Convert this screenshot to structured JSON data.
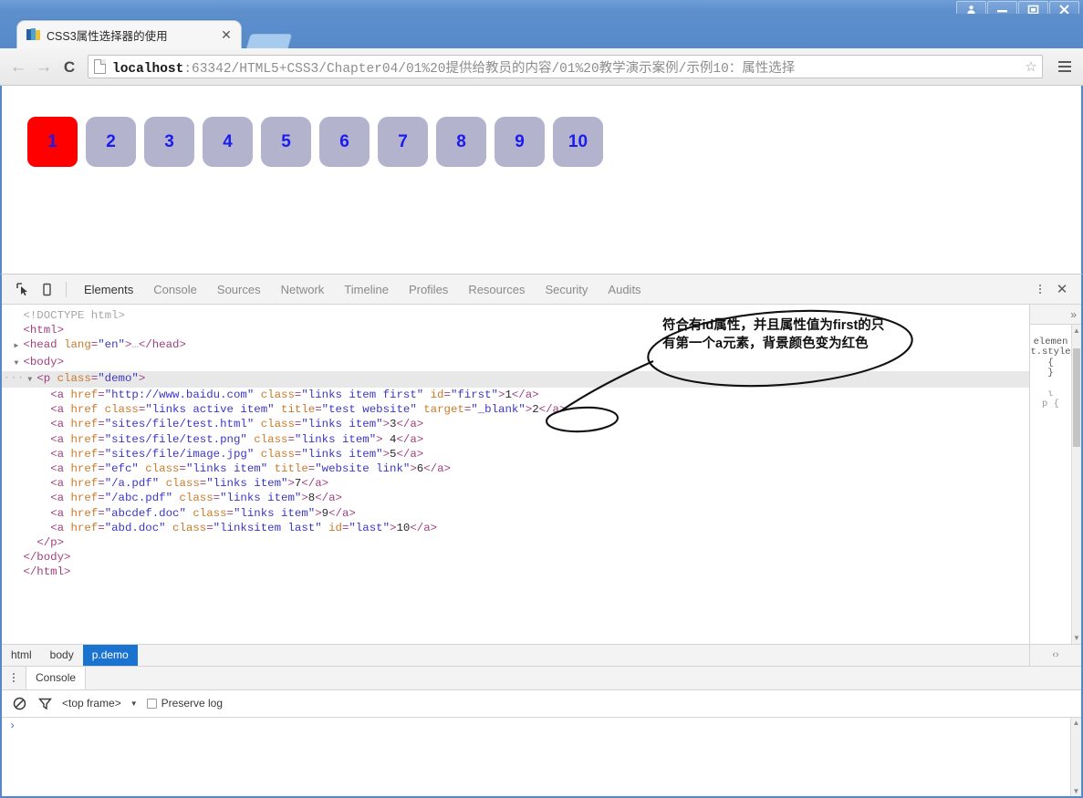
{
  "window": {
    "controls": [
      {
        "name": "user-profile",
        "glyph": "☻"
      },
      {
        "name": "minimize",
        "glyph": "–"
      },
      {
        "name": "maximize",
        "glyph": "□"
      },
      {
        "name": "close",
        "glyph": "✕"
      }
    ]
  },
  "tab": {
    "title": "CSS3属性选择器的使用",
    "close_label": "✕",
    "favicon_name": "page-favicon"
  },
  "toolbar": {
    "back_label": "←",
    "forward_label": "→",
    "reload_label": "C",
    "url_host": "localhost",
    "url_rest": ":63342/HTML5+CSS3/Chapter04/01%20提供给教员的内容/01%20教学演示案例/示例10：属性选择",
    "star_label": "☆",
    "menu_name": "chrome-menu-icon"
  },
  "page": {
    "links": [
      {
        "label": "1",
        "active": true
      },
      {
        "label": "2",
        "active": false
      },
      {
        "label": "3",
        "active": false
      },
      {
        "label": "4",
        "active": false
      },
      {
        "label": "5",
        "active": false
      },
      {
        "label": "6",
        "active": false
      },
      {
        "label": "7",
        "active": false
      },
      {
        "label": "8",
        "active": false
      },
      {
        "label": "9",
        "active": false
      },
      {
        "label": "10",
        "active": false
      }
    ],
    "active_color": "#fe0000",
    "inactive_color": "#b3b3cd",
    "number_color": "#1b1bf0"
  },
  "devtools": {
    "inspect_icon": "inspect-element-icon",
    "device_icon": "device-toolbar-icon",
    "tabs": [
      {
        "label": "Elements",
        "active": true
      },
      {
        "label": "Console",
        "active": false
      },
      {
        "label": "Sources",
        "active": false
      },
      {
        "label": "Network",
        "active": false
      },
      {
        "label": "Timeline",
        "active": false
      },
      {
        "label": "Profiles",
        "active": false
      },
      {
        "label": "Resources",
        "active": false
      },
      {
        "label": "Security",
        "active": false
      },
      {
        "label": "Audits",
        "active": false
      }
    ],
    "more_label": "⋮",
    "close_label": "✕",
    "dom": [
      {
        "indent": 0,
        "arrow": "",
        "selected": false,
        "dots": false,
        "parts": [
          {
            "c": "dim",
            "t": "<!DOCTYPE html>"
          }
        ]
      },
      {
        "indent": 0,
        "arrow": "",
        "selected": false,
        "dots": false,
        "parts": [
          {
            "c": "tag",
            "t": "<html>"
          }
        ]
      },
      {
        "indent": 0,
        "arrow": "▶",
        "selected": false,
        "dots": false,
        "parts": [
          {
            "c": "tag",
            "t": "<head "
          },
          {
            "c": "attr",
            "t": "lang"
          },
          {
            "c": "tag",
            "t": "="
          },
          {
            "c": "val",
            "t": "\"en\""
          },
          {
            "c": "tag",
            "t": ">"
          },
          {
            "c": "dim",
            "t": "…"
          },
          {
            "c": "tag",
            "t": "</head>"
          }
        ]
      },
      {
        "indent": 0,
        "arrow": "▼",
        "selected": false,
        "dots": false,
        "parts": [
          {
            "c": "tag",
            "t": "<body>"
          }
        ]
      },
      {
        "indent": 1,
        "arrow": "▼",
        "selected": true,
        "dots": true,
        "parts": [
          {
            "c": "tag",
            "t": "<p "
          },
          {
            "c": "attr",
            "t": "class"
          },
          {
            "c": "tag",
            "t": "="
          },
          {
            "c": "val",
            "t": "\"demo\""
          },
          {
            "c": "tag",
            "t": ">"
          }
        ]
      },
      {
        "indent": 2,
        "arrow": "",
        "selected": false,
        "dots": false,
        "parts": [
          {
            "c": "tag",
            "t": "<a "
          },
          {
            "c": "attr",
            "t": "href"
          },
          {
            "c": "tag",
            "t": "="
          },
          {
            "c": "val",
            "t": "\"http://www.baidu.com\""
          },
          {
            "c": "attr",
            "t": " class"
          },
          {
            "c": "tag",
            "t": "="
          },
          {
            "c": "val",
            "t": "\"links item first\""
          },
          {
            "c": "attr",
            "t": " id"
          },
          {
            "c": "tag",
            "t": "="
          },
          {
            "c": "val",
            "t": "\"first\""
          },
          {
            "c": "tag",
            "t": ">"
          },
          {
            "c": "txt",
            "t": "1"
          },
          {
            "c": "tag",
            "t": "</a>"
          }
        ]
      },
      {
        "indent": 2,
        "arrow": "",
        "selected": false,
        "dots": false,
        "parts": [
          {
            "c": "tag",
            "t": "<a "
          },
          {
            "c": "attr",
            "t": "href"
          },
          {
            "c": "attr",
            "t": " class"
          },
          {
            "c": "tag",
            "t": "="
          },
          {
            "c": "val",
            "t": "\"links active item\""
          },
          {
            "c": "attr",
            "t": " title"
          },
          {
            "c": "tag",
            "t": "="
          },
          {
            "c": "val",
            "t": "\"test website\""
          },
          {
            "c": "attr",
            "t": " target"
          },
          {
            "c": "tag",
            "t": "="
          },
          {
            "c": "val",
            "t": "\"_blank\""
          },
          {
            "c": "tag",
            "t": ">"
          },
          {
            "c": "txt",
            "t": "2"
          },
          {
            "c": "tag",
            "t": "</a>"
          }
        ]
      },
      {
        "indent": 2,
        "arrow": "",
        "selected": false,
        "dots": false,
        "parts": [
          {
            "c": "tag",
            "t": "<a "
          },
          {
            "c": "attr",
            "t": "href"
          },
          {
            "c": "tag",
            "t": "="
          },
          {
            "c": "val",
            "t": "\"sites/file/test.html\""
          },
          {
            "c": "attr",
            "t": " class"
          },
          {
            "c": "tag",
            "t": "="
          },
          {
            "c": "val",
            "t": "\"links item\""
          },
          {
            "c": "tag",
            "t": ">"
          },
          {
            "c": "txt",
            "t": "3"
          },
          {
            "c": "tag",
            "t": "</a>"
          }
        ]
      },
      {
        "indent": 2,
        "arrow": "",
        "selected": false,
        "dots": false,
        "parts": [
          {
            "c": "tag",
            "t": "<a "
          },
          {
            "c": "attr",
            "t": "href"
          },
          {
            "c": "tag",
            "t": "="
          },
          {
            "c": "val",
            "t": "\"sites/file/test.png\""
          },
          {
            "c": "attr",
            "t": " class"
          },
          {
            "c": "tag",
            "t": "="
          },
          {
            "c": "val",
            "t": "\"links item\""
          },
          {
            "c": "tag",
            "t": ">"
          },
          {
            "c": "txt",
            "t": " 4"
          },
          {
            "c": "tag",
            "t": "</a>"
          }
        ]
      },
      {
        "indent": 2,
        "arrow": "",
        "selected": false,
        "dots": false,
        "parts": [
          {
            "c": "tag",
            "t": "<a "
          },
          {
            "c": "attr",
            "t": "href"
          },
          {
            "c": "tag",
            "t": "="
          },
          {
            "c": "val",
            "t": "\"sites/file/image.jpg\""
          },
          {
            "c": "attr",
            "t": " class"
          },
          {
            "c": "tag",
            "t": "="
          },
          {
            "c": "val",
            "t": "\"links item\""
          },
          {
            "c": "tag",
            "t": ">"
          },
          {
            "c": "txt",
            "t": "5"
          },
          {
            "c": "tag",
            "t": "</a>"
          }
        ]
      },
      {
        "indent": 2,
        "arrow": "",
        "selected": false,
        "dots": false,
        "parts": [
          {
            "c": "tag",
            "t": "<a "
          },
          {
            "c": "attr",
            "t": "href"
          },
          {
            "c": "tag",
            "t": "="
          },
          {
            "c": "val",
            "t": "\"efc\""
          },
          {
            "c": "attr",
            "t": " class"
          },
          {
            "c": "tag",
            "t": "="
          },
          {
            "c": "val",
            "t": "\"links item\""
          },
          {
            "c": "attr",
            "t": " title"
          },
          {
            "c": "tag",
            "t": "="
          },
          {
            "c": "val",
            "t": "\"website link\""
          },
          {
            "c": "tag",
            "t": ">"
          },
          {
            "c": "txt",
            "t": "6"
          },
          {
            "c": "tag",
            "t": "</a>"
          }
        ]
      },
      {
        "indent": 2,
        "arrow": "",
        "selected": false,
        "dots": false,
        "parts": [
          {
            "c": "tag",
            "t": "<a "
          },
          {
            "c": "attr",
            "t": "href"
          },
          {
            "c": "tag",
            "t": "="
          },
          {
            "c": "val",
            "t": "\"/a.pdf\""
          },
          {
            "c": "attr",
            "t": " class"
          },
          {
            "c": "tag",
            "t": "="
          },
          {
            "c": "val",
            "t": "\"links item\""
          },
          {
            "c": "tag",
            "t": ">"
          },
          {
            "c": "txt",
            "t": "7"
          },
          {
            "c": "tag",
            "t": "</a>"
          }
        ]
      },
      {
        "indent": 2,
        "arrow": "",
        "selected": false,
        "dots": false,
        "parts": [
          {
            "c": "tag",
            "t": "<a "
          },
          {
            "c": "attr",
            "t": "href"
          },
          {
            "c": "tag",
            "t": "="
          },
          {
            "c": "val",
            "t": "\"/abc.pdf\""
          },
          {
            "c": "attr",
            "t": " class"
          },
          {
            "c": "tag",
            "t": "="
          },
          {
            "c": "val",
            "t": "\"links item\""
          },
          {
            "c": "tag",
            "t": ">"
          },
          {
            "c": "txt",
            "t": "8"
          },
          {
            "c": "tag",
            "t": "</a>"
          }
        ]
      },
      {
        "indent": 2,
        "arrow": "",
        "selected": false,
        "dots": false,
        "parts": [
          {
            "c": "tag",
            "t": "<a "
          },
          {
            "c": "attr",
            "t": "href"
          },
          {
            "c": "tag",
            "t": "="
          },
          {
            "c": "val",
            "t": "\"abcdef.doc\""
          },
          {
            "c": "attr",
            "t": " class"
          },
          {
            "c": "tag",
            "t": "="
          },
          {
            "c": "val",
            "t": "\"links item\""
          },
          {
            "c": "tag",
            "t": ">"
          },
          {
            "c": "txt",
            "t": "9"
          },
          {
            "c": "tag",
            "t": "</a>"
          }
        ]
      },
      {
        "indent": 2,
        "arrow": "",
        "selected": false,
        "dots": false,
        "parts": [
          {
            "c": "tag",
            "t": "<a "
          },
          {
            "c": "attr",
            "t": "href"
          },
          {
            "c": "tag",
            "t": "="
          },
          {
            "c": "val",
            "t": "\"abd.doc\""
          },
          {
            "c": "attr",
            "t": " class"
          },
          {
            "c": "tag",
            "t": "="
          },
          {
            "c": "val",
            "t": "\"linksitem last\""
          },
          {
            "c": "attr",
            "t": " id"
          },
          {
            "c": "tag",
            "t": "="
          },
          {
            "c": "val",
            "t": "\"last\""
          },
          {
            "c": "tag",
            "t": ">"
          },
          {
            "c": "txt",
            "t": "10"
          },
          {
            "c": "tag",
            "t": "</a>"
          }
        ]
      },
      {
        "indent": 1,
        "arrow": "",
        "selected": false,
        "dots": false,
        "parts": [
          {
            "c": "tag",
            "t": "</p>"
          }
        ]
      },
      {
        "indent": 0,
        "arrow": "",
        "selected": false,
        "dots": false,
        "parts": [
          {
            "c": "tag",
            "t": "</body>"
          }
        ]
      },
      {
        "indent": 0,
        "arrow": "",
        "selected": false,
        "dots": false,
        "parts": [
          {
            "c": "tag",
            "t": "</html>"
          }
        ]
      }
    ],
    "styles_sidebar": {
      "expand_label": "»",
      "rule_1": "element.style {\n}",
      "rule_2": "ι\np {"
    },
    "breadcrumb": [
      {
        "label": "html",
        "active": false
      },
      {
        "label": "body",
        "active": false
      },
      {
        "label": "p.demo",
        "active": true
      }
    ],
    "breadcrumb_more": "‹›",
    "drawer": {
      "more_label": "⋮",
      "tab_label": "Console",
      "clear_icon": "clear-console-icon",
      "filter_icon": "filter-icon",
      "frame_label": "<top frame>",
      "frame_caret": "▼",
      "preserve_log_label": "Preserve log",
      "preserve_log_checked": false,
      "prompt": "›"
    }
  },
  "annotation": {
    "text_line_1": "符合有id属性，并且属性值为first的只",
    "text_line_2": "有第一个a元素，背景颜色变为红色",
    "stroke_color": "#111111"
  }
}
